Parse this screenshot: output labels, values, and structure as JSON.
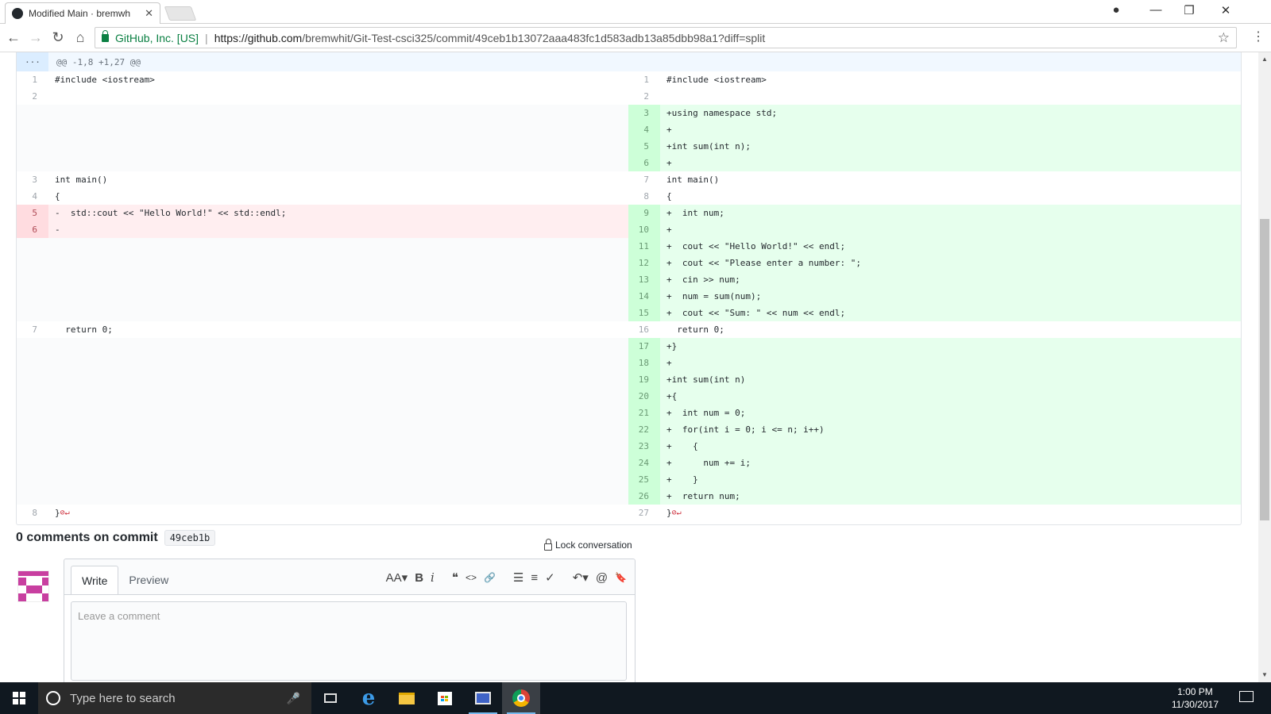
{
  "browser": {
    "tab_title": "Modified Main · bremwh",
    "tab_close": "✕",
    "security_label": "GitHub, Inc. [US]",
    "url_host": "https://github.com",
    "url_path": "/bremwhit/Git-Test-csci325/commit/49ceb1b13072aaa483fc1d583adb13a85dbb98a1?diff=split",
    "accent": "#0b8043"
  },
  "diff": {
    "expander": "...",
    "hunk_header": "@@ -1,8 +1,27 @@",
    "rows": [
      {
        "l": {
          "n": "1",
          "c": "#include <iostream>",
          "t": "ctx"
        },
        "r": {
          "n": "1",
          "c": "#include <iostream>",
          "t": "ctx"
        }
      },
      {
        "l": {
          "n": "2",
          "c": "",
          "t": "ctx"
        },
        "r": {
          "n": "2",
          "c": "",
          "t": "ctx"
        }
      },
      {
        "l": {
          "t": "empty"
        },
        "r": {
          "n": "3",
          "c": "+using namespace std;",
          "t": "add"
        }
      },
      {
        "l": {
          "t": "empty"
        },
        "r": {
          "n": "4",
          "c": "+",
          "t": "add"
        }
      },
      {
        "l": {
          "t": "empty"
        },
        "r": {
          "n": "5",
          "c": "+int sum(int n);",
          "t": "add"
        }
      },
      {
        "l": {
          "t": "empty"
        },
        "r": {
          "n": "6",
          "c": "+",
          "t": "add"
        }
      },
      {
        "l": {
          "n": "3",
          "c": "int main()",
          "t": "ctx"
        },
        "r": {
          "n": "7",
          "c": "int main()",
          "t": "ctx"
        }
      },
      {
        "l": {
          "n": "4",
          "c": "{",
          "t": "ctx"
        },
        "r": {
          "n": "8",
          "c": "{",
          "t": "ctx"
        }
      },
      {
        "l": {
          "n": "5",
          "c": "-  std::cout << \"Hello World!\" << std::endl;",
          "t": "del"
        },
        "r": {
          "n": "9",
          "c": "+  int num;",
          "t": "add"
        }
      },
      {
        "l": {
          "n": "6",
          "c": "-",
          "t": "del"
        },
        "r": {
          "n": "10",
          "c": "+",
          "t": "add"
        }
      },
      {
        "l": {
          "t": "empty"
        },
        "r": {
          "n": "11",
          "c": "+  cout << \"Hello World!\" << endl;",
          "t": "add"
        }
      },
      {
        "l": {
          "t": "empty"
        },
        "r": {
          "n": "12",
          "c": "+  cout << \"Please enter a number: \";",
          "t": "add"
        }
      },
      {
        "l": {
          "t": "empty"
        },
        "r": {
          "n": "13",
          "c": "+  cin >> num;",
          "t": "add"
        }
      },
      {
        "l": {
          "t": "empty"
        },
        "r": {
          "n": "14",
          "c": "+  num = sum(num);",
          "t": "add"
        }
      },
      {
        "l": {
          "t": "empty"
        },
        "r": {
          "n": "15",
          "c": "+  cout << \"Sum: \" << num << endl;",
          "t": "add"
        }
      },
      {
        "l": {
          "n": "7",
          "c": "  return 0;",
          "t": "ctx"
        },
        "r": {
          "n": "16",
          "c": "  return 0;",
          "t": "ctx"
        }
      },
      {
        "l": {
          "t": "empty"
        },
        "r": {
          "n": "17",
          "c": "+}",
          "t": "add"
        }
      },
      {
        "l": {
          "t": "empty"
        },
        "r": {
          "n": "18",
          "c": "+",
          "t": "add"
        }
      },
      {
        "l": {
          "t": "empty"
        },
        "r": {
          "n": "19",
          "c": "+int sum(int n)",
          "t": "add"
        }
      },
      {
        "l": {
          "t": "empty"
        },
        "r": {
          "n": "20",
          "c": "+{",
          "t": "add"
        }
      },
      {
        "l": {
          "t": "empty"
        },
        "r": {
          "n": "21",
          "c": "+  int num = 0;",
          "t": "add"
        }
      },
      {
        "l": {
          "t": "empty"
        },
        "r": {
          "n": "22",
          "c": "+  for(int i = 0; i <= n; i++)",
          "t": "add"
        }
      },
      {
        "l": {
          "t": "empty"
        },
        "r": {
          "n": "23",
          "c": "+    {",
          "t": "add"
        }
      },
      {
        "l": {
          "t": "empty"
        },
        "r": {
          "n": "24",
          "c": "+      num += i;",
          "t": "add"
        }
      },
      {
        "l": {
          "t": "empty"
        },
        "r": {
          "n": "25",
          "c": "+    }",
          "t": "add"
        }
      },
      {
        "l": {
          "t": "empty"
        },
        "r": {
          "n": "26",
          "c": "+  return num;",
          "t": "add"
        }
      },
      {
        "l": {
          "n": "8",
          "c": "}",
          "t": "ctx",
          "noeol": true
        },
        "r": {
          "n": "27",
          "c": "}",
          "t": "ctx",
          "noeol": true
        }
      }
    ],
    "noeol_marker": "⊘↵"
  },
  "comments": {
    "title": "0 comments on commit",
    "sha": "49ceb1b",
    "lock_label": "Lock conversation",
    "write_tab": "Write",
    "preview_tab": "Preview",
    "placeholder": "Leave a comment",
    "toolbar": {
      "header": "AA▾",
      "bold": "B",
      "italic": "i",
      "quote": "❝",
      "code": "<>",
      "link": "🔗",
      "ul": "☰",
      "ol": "≡",
      "tasks": "✓",
      "reply": "↶▾",
      "mention": "@",
      "saved": "🔖"
    }
  },
  "taskbar": {
    "search_placeholder": "Type here to search",
    "time": "1:00 PM",
    "date": "11/30/2017"
  }
}
